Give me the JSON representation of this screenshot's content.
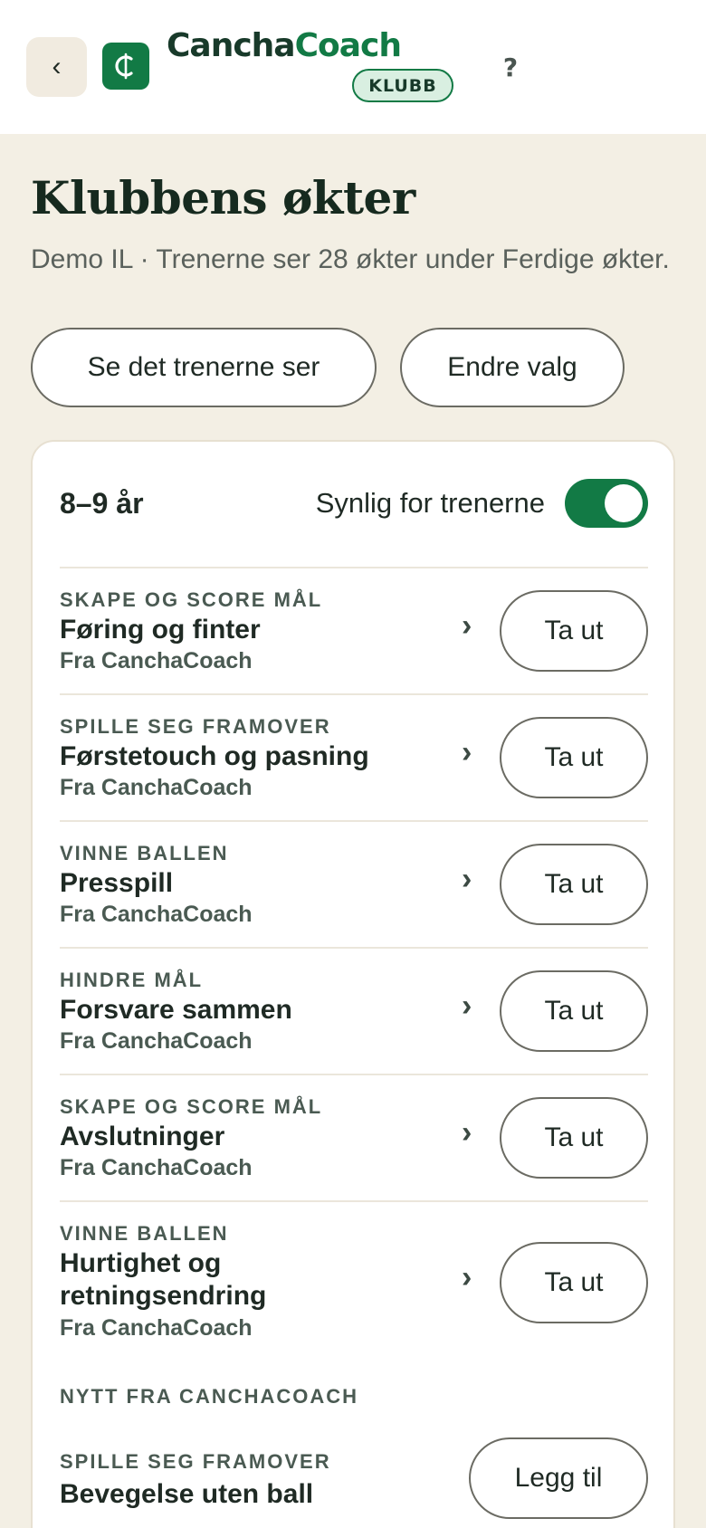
{
  "header": {
    "back_label": "‹",
    "brand_first": "Cancha",
    "brand_second": "Coach",
    "badge": "KLUBB",
    "help_label": "?"
  },
  "page": {
    "title": "Klubbens økter",
    "subtitle": "Demo IL · Trenerne ser 28 økter under Ferdige økter.",
    "actions": {
      "preview_label": "Se det trenerne ser",
      "change_label": "Endre valg"
    }
  },
  "card": {
    "age_group": "8–9 år",
    "visibility_label": "Synlig for trenerne",
    "visibility_on": true,
    "sessions": [
      {
        "category": "SKAPE OG SCORE MÅL",
        "name": "Føring og finter",
        "source": "Fra CanchaCoach",
        "action": "Ta ut"
      },
      {
        "category": "SPILLE SEG FRAMOVER",
        "name": "Førstetouch og pasning",
        "source": "Fra CanchaCoach",
        "action": "Ta ut"
      },
      {
        "category": "VINNE BALLEN",
        "name": "Presspill",
        "source": "Fra CanchaCoach",
        "action": "Ta ut"
      },
      {
        "category": "HINDRE MÅL",
        "name": "Forsvare sammen",
        "source": "Fra CanchaCoach",
        "action": "Ta ut"
      },
      {
        "category": "SKAPE OG SCORE MÅL",
        "name": "Avslutninger",
        "source": "Fra CanchaCoach",
        "action": "Ta ut"
      },
      {
        "category": "VINNE BALLEN",
        "name": "Hurtighet og retningsendring",
        "source": "Fra CanchaCoach",
        "action": "Ta ut"
      }
    ],
    "new_section_title": "NYTT FRA CANCHACOACH",
    "new_sessions": [
      {
        "category": "SPILLE SEG FRAMOVER",
        "name": "Bevegelse uten ball",
        "action": "Legg til"
      }
    ]
  },
  "colors": {
    "brand_green": "#127a45",
    "background": "#f3efe4"
  }
}
